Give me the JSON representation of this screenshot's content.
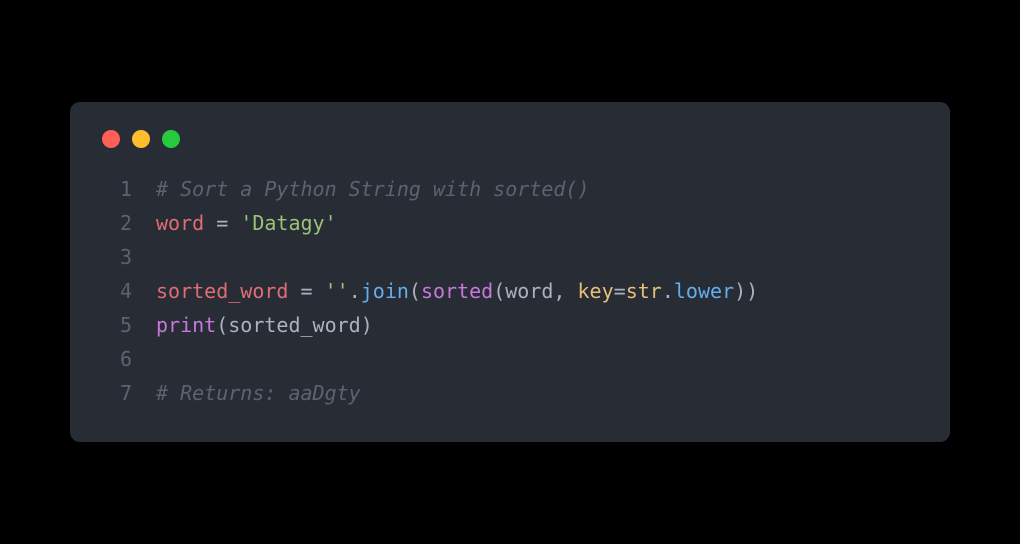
{
  "window": {
    "controls": {
      "close": "close",
      "minimize": "minimize",
      "maximize": "maximize"
    }
  },
  "code": {
    "lines": [
      {
        "num": "1"
      },
      {
        "num": "2"
      },
      {
        "num": "3"
      },
      {
        "num": "4"
      },
      {
        "num": "5"
      },
      {
        "num": "6"
      },
      {
        "num": "7"
      }
    ],
    "tokens": {
      "l1_comment": "# Sort a Python String with sorted()",
      "l2_var": "word",
      "l2_sp1": " ",
      "l2_op": "=",
      "l2_sp2": " ",
      "l2_str": "'Datagy'",
      "l4_var": "sorted_word",
      "l4_sp1": " ",
      "l4_op": "=",
      "l4_sp2": " ",
      "l4_str": "''",
      "l4_dot": ".",
      "l4_join": "join",
      "l4_p1o": "(",
      "l4_sorted": "sorted",
      "l4_p2o": "(",
      "l4_arg1": "word",
      "l4_comma": ", ",
      "l4_key": "key",
      "l4_eq": "=",
      "l4_str_cls": "str",
      "l4_dot2": ".",
      "l4_lower": "lower",
      "l4_p2c": ")",
      "l4_p1c": ")",
      "l5_print": "print",
      "l5_p1o": "(",
      "l5_arg": "sorted_word",
      "l5_p1c": ")",
      "l7_comment": "# Returns: aaDgty"
    }
  }
}
